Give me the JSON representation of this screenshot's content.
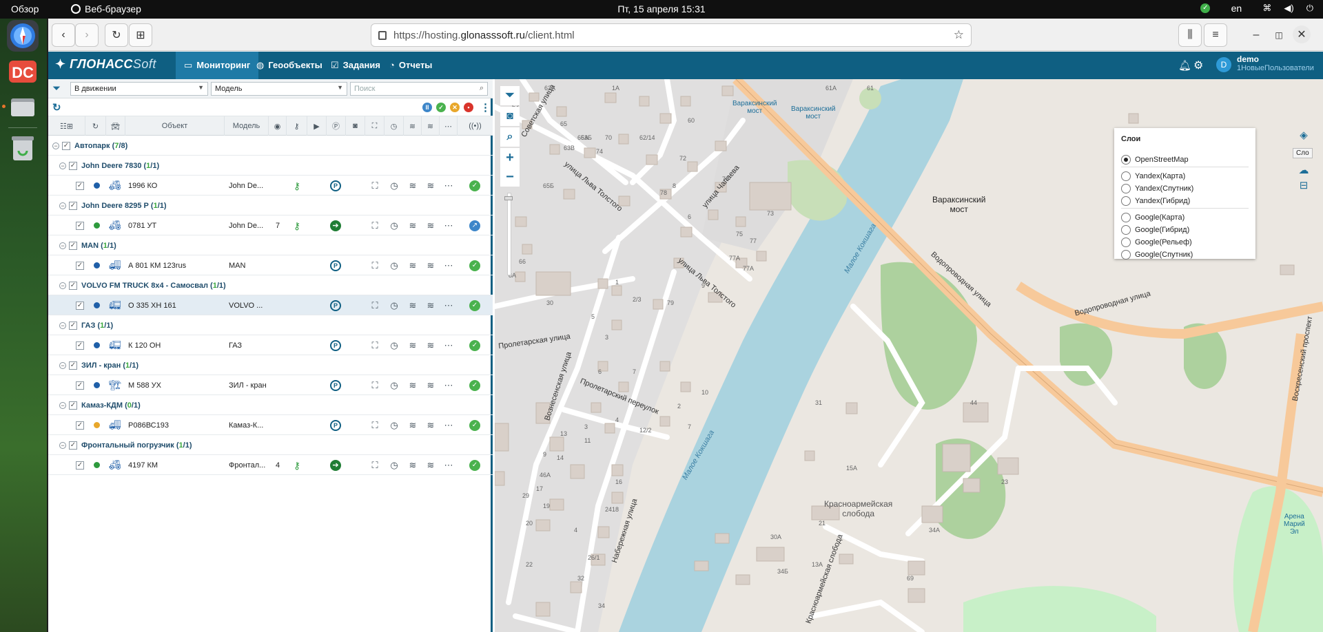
{
  "system": {
    "activities": "Обзор",
    "app_name": "Веб-браузер",
    "clock": "Пт, 15 апреля  15:31",
    "keyboard_layout": "en"
  },
  "browser": {
    "url_prefix": "https://hosting.",
    "url_domain": "glonasssoft.ru",
    "url_path": "/client.html"
  },
  "app": {
    "logo_main": "ГЛОНАСС",
    "logo_soft": "Soft",
    "tabs": [
      {
        "label": "Мониторинг",
        "icon": "monitor-icon"
      },
      {
        "label": "Геообъекты",
        "icon": "globe-icon"
      },
      {
        "label": "Задания",
        "icon": "clipboard-icon"
      },
      {
        "label": "Отчеты",
        "icon": "report-icon"
      }
    ],
    "user": {
      "initial": "D",
      "name": "demo",
      "group": "1НовыеПользователи"
    }
  },
  "filters": {
    "state": "В движении",
    "model": "Модель",
    "search_placeholder": "Поиск"
  },
  "columns": {
    "object": "Объект",
    "model": "Модель"
  },
  "tree": {
    "root": {
      "name": "Автопарк",
      "on": "7",
      "total": "8"
    },
    "groups": [
      {
        "name": "John Deere 7830",
        "on": "1",
        "total": "1",
        "unit": {
          "plate": "1996 КО",
          "model": "John De...",
          "count": "",
          "status_color": "#1f5fa8",
          "vehicle": "tractor",
          "key": true,
          "arrow": false,
          "state": "ok"
        }
      },
      {
        "name": "John Deere 8295 Р",
        "on": "1",
        "total": "1",
        "unit": {
          "plate": "0781 УТ",
          "model": "John De...",
          "count": "7",
          "status_color": "#2e9a3d",
          "vehicle": "tractor",
          "key": true,
          "arrow": true,
          "state": "blue"
        }
      },
      {
        "name": "MAN",
        "on": "1",
        "total": "1",
        "unit": {
          "plate": "А 801 КМ 123rus",
          "model": "MAN",
          "count": "",
          "status_color": "#1f5fa8",
          "vehicle": "truck",
          "key": false,
          "arrow": false,
          "state": "ok"
        }
      },
      {
        "name": "VOLVO FM TRUCK 8x4 - Самосвал",
        "on": "1",
        "total": "1",
        "unit": {
          "plate": "О 335 ХН 161",
          "model": "VOLVO ...",
          "count": "",
          "status_color": "#1f5fa8",
          "vehicle": "dumptruck",
          "key": false,
          "arrow": false,
          "state": "ok"
        }
      },
      {
        "name": "ГАЗ",
        "on": "1",
        "total": "1",
        "unit": {
          "plate": "К 120 ОН",
          "model": "ГАЗ",
          "count": "",
          "status_color": "#1f5fa8",
          "vehicle": "dumptruck",
          "key": false,
          "arrow": false,
          "state": "ok"
        }
      },
      {
        "name": "ЗИЛ - кран",
        "on": "1",
        "total": "1",
        "unit": {
          "plate": "М 588 УХ",
          "model": "ЗИЛ - кран",
          "count": "",
          "status_color": "#1f5fa8",
          "vehicle": "crane",
          "key": false,
          "arrow": false,
          "state": "ok"
        }
      },
      {
        "name": "Камаз-КДМ",
        "on": "0",
        "total": "1",
        "unit": {
          "plate": "Р086ВС193",
          "model": "Камаз-К...",
          "count": "",
          "status_color": "#e8a72b",
          "vehicle": "truck",
          "key": false,
          "arrow": false,
          "state": "ok"
        }
      },
      {
        "name": "Фронтальный погрузчик",
        "on": "1",
        "total": "1",
        "unit": {
          "plate": "4197 КМ",
          "model": "Фронтал...",
          "count": "4",
          "status_color": "#2e9a3d",
          "vehicle": "loader",
          "key": true,
          "arrow": true,
          "state": "ok"
        }
      }
    ]
  },
  "layers": {
    "title": "Слои",
    "options": [
      "OpenStreetMap",
      "Yandex(Карта)",
      "Yandex(Спутник)",
      "Yandex(Гибрид)",
      "Google(Карта)",
      "Google(Гибрид)",
      "Google(Рельеф)",
      "Google(Спутник)"
    ],
    "selected": "OpenStreetMap",
    "tooltip": "Сло"
  },
  "map_labels": {
    "bridge_small_1": "Вараксинский\nмост",
    "bridge_small_2": "Вараксинский\nмост",
    "bridge_big": "Вараксинский\nмост",
    "street_tolstoy_1": "улица Льва Толстого",
    "street_tolstoy_2": "улица Льва Толстого",
    "street_chapaeva": "улица Чапаева",
    "street_sovetskaya": "Советская улица",
    "street_proletarskaya": "Пролетарская улица",
    "street_voznesenskaya": "Вознесенская улица",
    "lane_proletarsky": "Пролетарский переулок",
    "street_naberezhnaya": "Набережная улица",
    "street_vodoprovodnaya_1": "Водопроводная улица",
    "street_vodoprovodnaya_2": "Водопроводная улица",
    "prospect_voskresensky": "Воскресенский проспект",
    "river_1": "Малое Кокшага",
    "river_2": "Малое Кокшага",
    "district": "Красноармейская\nслобода",
    "street_krasnoarmeyskaya": "Красноармейская слобода",
    "arena": "Арена\nМарий\nЭл",
    "houses": [
      "63А",
      "1А",
      "61А",
      "61",
      "63",
      "65",
      "63Б",
      "70",
      "62/14",
      "60",
      "65А",
      "65Б",
      "63В",
      "74",
      "72",
      "76",
      "8",
      "6",
      "78",
      "73",
      "75",
      "77А",
      "77",
      "9",
      "66",
      "8А",
      "79",
      "77А",
      "30",
      "1",
      "2/3",
      "5",
      "3",
      "7",
      "6",
      "4",
      "2",
      "10",
      "12/2",
      "7",
      "3",
      "31",
      "44",
      "13",
      "11",
      "9",
      "14",
      "16",
      "17",
      "19",
      "18",
      "20",
      "22",
      "24",
      "4",
      "26/1",
      "32",
      "34",
      "29",
      "46А",
      "23",
      "15А",
      "13А",
      "21",
      "34Б",
      "30А",
      "34А",
      "69"
    ]
  }
}
